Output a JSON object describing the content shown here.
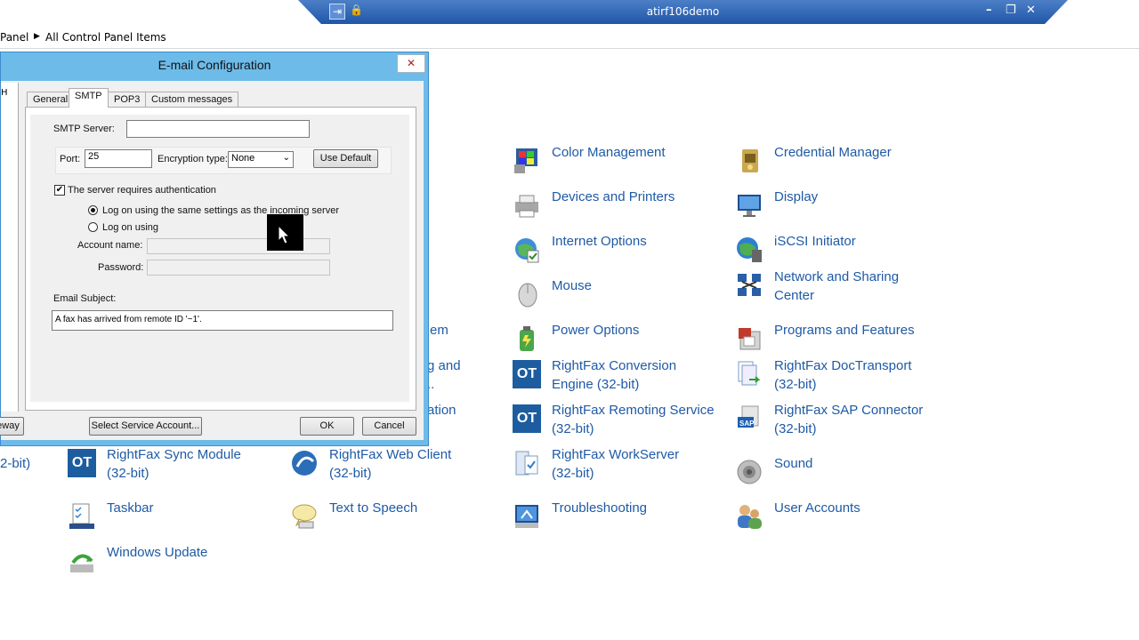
{
  "rdp": {
    "title": "atirf106demo"
  },
  "breadcrumb": {
    "part1": "Panel",
    "part2": "All Control Panel Items"
  },
  "cp_items": {
    "color_management": "Color Management",
    "credential_manager": "Credential Manager",
    "devices_printers": "Devices and Printers",
    "display": "Display",
    "internet_options": "Internet Options",
    "iscsi": "iSCSI Initiator",
    "mouse": "Mouse",
    "network_sharing_1": "Network and Sharing",
    "network_sharing_2": "Center",
    "power_options": "Power Options",
    "programs_features": "Programs and Features",
    "rf_conversion_1": "RightFax Conversion",
    "rf_conversion_2": "Engine (32-bit)",
    "rf_doctransport_1": "RightFax DocTransport",
    "rf_doctransport_2": "(32-bit)",
    "rf_remoting_1": "RightFax Remoting Service",
    "rf_remoting_2": "(32-bit)",
    "rf_sap_1": "RightFax SAP Connector",
    "rf_sap_2": "(32-bit)",
    "rf_sync_1": "RightFax Sync Module",
    "rf_sync_2": "(32-bit)",
    "rf_web_1": "RightFax Web Client",
    "rf_web_2": "(32-bit)",
    "rf_workserver_1": "RightFax WorkServer",
    "rf_workserver_2": "(32-bit)",
    "sound": "Sound",
    "taskbar": "Taskbar",
    "text_to_speech": "Text to Speech",
    "troubleshooting": "Troubleshooting",
    "user_accounts": "User Accounts",
    "windows_update": "Windows Update",
    "partial_em": "em",
    "partial_gand": "g and",
    "partial_dots": "..",
    "partial_ation": "ation",
    "partial_2bit": "2-bit)"
  },
  "dialog": {
    "title": "E-mail Configuration",
    "close": "✕",
    "left_strip_char": "H",
    "tabs": [
      "General",
      "SMTP",
      "POP3",
      "Custom messages"
    ],
    "smtp_server_label": "SMTP Server:",
    "smtp_server_value": "",
    "port_label": "Port:",
    "port_value": "25",
    "encryption_label": "Encryption type:",
    "encryption_value": "None",
    "use_default": "Use Default",
    "auth_label": "The server requires authentication",
    "radio_same": "Log on using the same settings as the incoming server",
    "radio_logon": "Log on using",
    "account_label": "Account name:",
    "password_label": "Password:",
    "subject_label": "Email Subject:",
    "subject_value": "A fax has arrived from remote ID '~1'.",
    "gateway_btn": "eway",
    "select_service": "Select Service Account...",
    "ok": "OK",
    "cancel": "Cancel"
  }
}
